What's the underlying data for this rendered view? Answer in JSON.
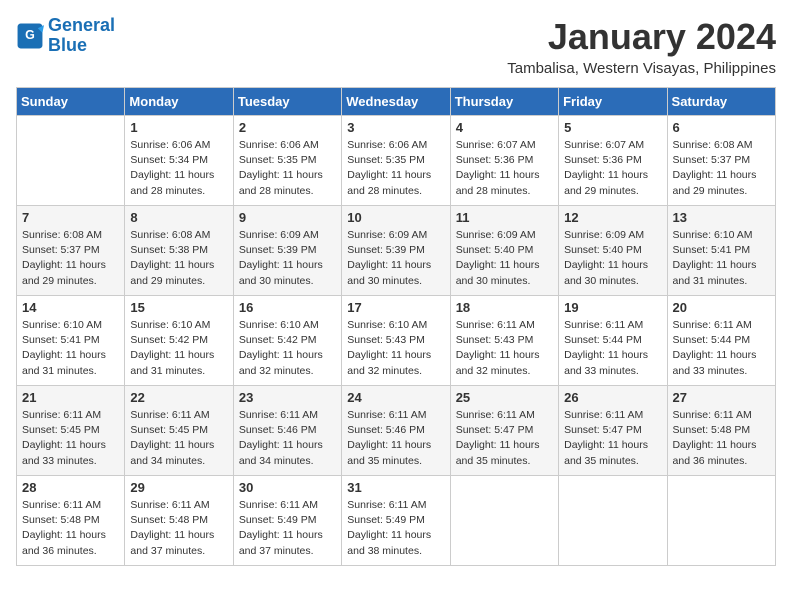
{
  "logo": {
    "line1": "General",
    "line2": "Blue"
  },
  "title": "January 2024",
  "location": "Tambalisa, Western Visayas, Philippines",
  "days_of_week": [
    "Sunday",
    "Monday",
    "Tuesday",
    "Wednesday",
    "Thursday",
    "Friday",
    "Saturday"
  ],
  "weeks": [
    [
      {
        "day": "",
        "sunrise": "",
        "sunset": "",
        "daylight": ""
      },
      {
        "day": "1",
        "sunrise": "Sunrise: 6:06 AM",
        "sunset": "Sunset: 5:34 PM",
        "daylight": "Daylight: 11 hours and 28 minutes."
      },
      {
        "day": "2",
        "sunrise": "Sunrise: 6:06 AM",
        "sunset": "Sunset: 5:35 PM",
        "daylight": "Daylight: 11 hours and 28 minutes."
      },
      {
        "day": "3",
        "sunrise": "Sunrise: 6:06 AM",
        "sunset": "Sunset: 5:35 PM",
        "daylight": "Daylight: 11 hours and 28 minutes."
      },
      {
        "day": "4",
        "sunrise": "Sunrise: 6:07 AM",
        "sunset": "Sunset: 5:36 PM",
        "daylight": "Daylight: 11 hours and 28 minutes."
      },
      {
        "day": "5",
        "sunrise": "Sunrise: 6:07 AM",
        "sunset": "Sunset: 5:36 PM",
        "daylight": "Daylight: 11 hours and 29 minutes."
      },
      {
        "day": "6",
        "sunrise": "Sunrise: 6:08 AM",
        "sunset": "Sunset: 5:37 PM",
        "daylight": "Daylight: 11 hours and 29 minutes."
      }
    ],
    [
      {
        "day": "7",
        "sunrise": "Sunrise: 6:08 AM",
        "sunset": "Sunset: 5:37 PM",
        "daylight": "Daylight: 11 hours and 29 minutes."
      },
      {
        "day": "8",
        "sunrise": "Sunrise: 6:08 AM",
        "sunset": "Sunset: 5:38 PM",
        "daylight": "Daylight: 11 hours and 29 minutes."
      },
      {
        "day": "9",
        "sunrise": "Sunrise: 6:09 AM",
        "sunset": "Sunset: 5:39 PM",
        "daylight": "Daylight: 11 hours and 30 minutes."
      },
      {
        "day": "10",
        "sunrise": "Sunrise: 6:09 AM",
        "sunset": "Sunset: 5:39 PM",
        "daylight": "Daylight: 11 hours and 30 minutes."
      },
      {
        "day": "11",
        "sunrise": "Sunrise: 6:09 AM",
        "sunset": "Sunset: 5:40 PM",
        "daylight": "Daylight: 11 hours and 30 minutes."
      },
      {
        "day": "12",
        "sunrise": "Sunrise: 6:09 AM",
        "sunset": "Sunset: 5:40 PM",
        "daylight": "Daylight: 11 hours and 30 minutes."
      },
      {
        "day": "13",
        "sunrise": "Sunrise: 6:10 AM",
        "sunset": "Sunset: 5:41 PM",
        "daylight": "Daylight: 11 hours and 31 minutes."
      }
    ],
    [
      {
        "day": "14",
        "sunrise": "Sunrise: 6:10 AM",
        "sunset": "Sunset: 5:41 PM",
        "daylight": "Daylight: 11 hours and 31 minutes."
      },
      {
        "day": "15",
        "sunrise": "Sunrise: 6:10 AM",
        "sunset": "Sunset: 5:42 PM",
        "daylight": "Daylight: 11 hours and 31 minutes."
      },
      {
        "day": "16",
        "sunrise": "Sunrise: 6:10 AM",
        "sunset": "Sunset: 5:42 PM",
        "daylight": "Daylight: 11 hours and 32 minutes."
      },
      {
        "day": "17",
        "sunrise": "Sunrise: 6:10 AM",
        "sunset": "Sunset: 5:43 PM",
        "daylight": "Daylight: 11 hours and 32 minutes."
      },
      {
        "day": "18",
        "sunrise": "Sunrise: 6:11 AM",
        "sunset": "Sunset: 5:43 PM",
        "daylight": "Daylight: 11 hours and 32 minutes."
      },
      {
        "day": "19",
        "sunrise": "Sunrise: 6:11 AM",
        "sunset": "Sunset: 5:44 PM",
        "daylight": "Daylight: 11 hours and 33 minutes."
      },
      {
        "day": "20",
        "sunrise": "Sunrise: 6:11 AM",
        "sunset": "Sunset: 5:44 PM",
        "daylight": "Daylight: 11 hours and 33 minutes."
      }
    ],
    [
      {
        "day": "21",
        "sunrise": "Sunrise: 6:11 AM",
        "sunset": "Sunset: 5:45 PM",
        "daylight": "Daylight: 11 hours and 33 minutes."
      },
      {
        "day": "22",
        "sunrise": "Sunrise: 6:11 AM",
        "sunset": "Sunset: 5:45 PM",
        "daylight": "Daylight: 11 hours and 34 minutes."
      },
      {
        "day": "23",
        "sunrise": "Sunrise: 6:11 AM",
        "sunset": "Sunset: 5:46 PM",
        "daylight": "Daylight: 11 hours and 34 minutes."
      },
      {
        "day": "24",
        "sunrise": "Sunrise: 6:11 AM",
        "sunset": "Sunset: 5:46 PM",
        "daylight": "Daylight: 11 hours and 35 minutes."
      },
      {
        "day": "25",
        "sunrise": "Sunrise: 6:11 AM",
        "sunset": "Sunset: 5:47 PM",
        "daylight": "Daylight: 11 hours and 35 minutes."
      },
      {
        "day": "26",
        "sunrise": "Sunrise: 6:11 AM",
        "sunset": "Sunset: 5:47 PM",
        "daylight": "Daylight: 11 hours and 35 minutes."
      },
      {
        "day": "27",
        "sunrise": "Sunrise: 6:11 AM",
        "sunset": "Sunset: 5:48 PM",
        "daylight": "Daylight: 11 hours and 36 minutes."
      }
    ],
    [
      {
        "day": "28",
        "sunrise": "Sunrise: 6:11 AM",
        "sunset": "Sunset: 5:48 PM",
        "daylight": "Daylight: 11 hours and 36 minutes."
      },
      {
        "day": "29",
        "sunrise": "Sunrise: 6:11 AM",
        "sunset": "Sunset: 5:48 PM",
        "daylight": "Daylight: 11 hours and 37 minutes."
      },
      {
        "day": "30",
        "sunrise": "Sunrise: 6:11 AM",
        "sunset": "Sunset: 5:49 PM",
        "daylight": "Daylight: 11 hours and 37 minutes."
      },
      {
        "day": "31",
        "sunrise": "Sunrise: 6:11 AM",
        "sunset": "Sunset: 5:49 PM",
        "daylight": "Daylight: 11 hours and 38 minutes."
      },
      {
        "day": "",
        "sunrise": "",
        "sunset": "",
        "daylight": ""
      },
      {
        "day": "",
        "sunrise": "",
        "sunset": "",
        "daylight": ""
      },
      {
        "day": "",
        "sunrise": "",
        "sunset": "",
        "daylight": ""
      }
    ]
  ]
}
